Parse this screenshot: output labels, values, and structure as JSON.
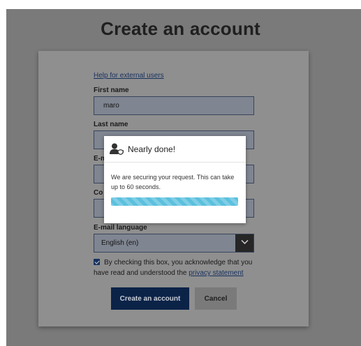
{
  "page": {
    "title": "Create an account"
  },
  "form": {
    "help_link": "Help for external users",
    "first_name_label": "First name",
    "first_name_value": "maro",
    "last_name_label": "Last name",
    "last_name_value": "",
    "email_label_partial": "E-m",
    "email_value": "",
    "confirm_email_label_partial": "Co",
    "confirm_email_value": "",
    "email_language_label": "E-mail language",
    "email_language_value": "English (en)",
    "consent_checked": true,
    "consent_text": "By checking this box, you acknowledge that you have read and understood the",
    "privacy_link": "privacy statement",
    "create_button": "Create an account",
    "cancel_button": "Cancel"
  },
  "modal": {
    "title": "Nearly done!",
    "message": "We are securing your request. This can take up to 60 seconds.",
    "progress_fraction": 1.0,
    "icon": "user-lock-icon"
  },
  "colors": {
    "overlay": "#7a7a7a",
    "primary_button": "#0c2348",
    "progress": "#5bc0de"
  }
}
